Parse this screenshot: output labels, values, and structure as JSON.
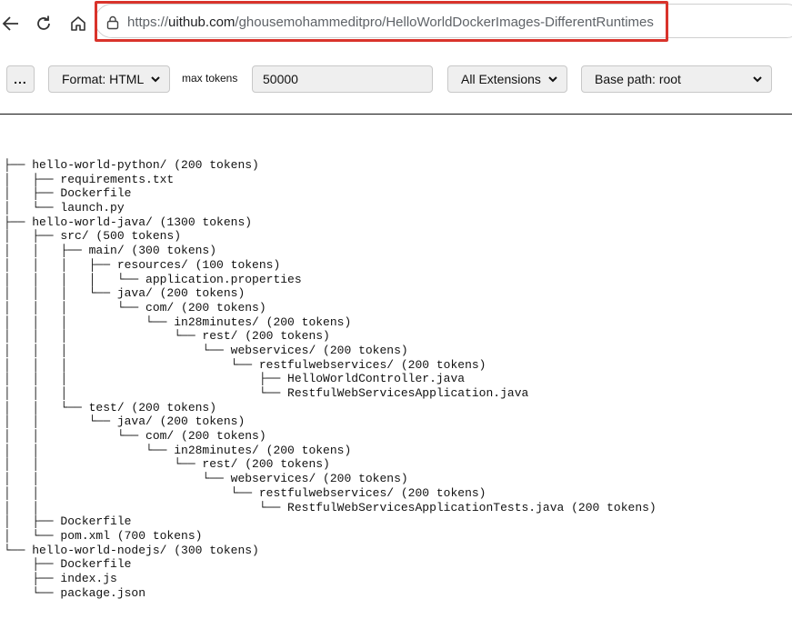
{
  "browser": {
    "url_prefix": "https://",
    "url_host": "uithub.com",
    "url_path": "/ghousemohammeditpro/HelloWorldDockerImages-DifferentRuntimes"
  },
  "toolbar": {
    "more_label": "...",
    "format_label": "Format: HTML",
    "max_tokens_label": "max tokens",
    "max_tokens_value": "50000",
    "extensions_label": "All Extensions",
    "base_path_label": "Base path: root"
  },
  "tree": [
    "├── hello-world-python/ (200 tokens)",
    "│   ├── requirements.txt",
    "│   ├── Dockerfile",
    "│   └── launch.py",
    "├── hello-world-java/ (1300 tokens)",
    "│   ├── src/ (500 tokens)",
    "│   │   ├── main/ (300 tokens)",
    "│   │   │   ├── resources/ (100 tokens)",
    "│   │   │   │   └── application.properties",
    "│   │   │   └── java/ (200 tokens)",
    "│   │   │       └── com/ (200 tokens)",
    "│   │   │           └── in28minutes/ (200 tokens)",
    "│   │   │               └── rest/ (200 tokens)",
    "│   │   │                   └── webservices/ (200 tokens)",
    "│   │   │                       └── restfulwebservices/ (200 tokens)",
    "│   │   │                           ├── HelloWorldController.java",
    "│   │   │                           └── RestfulWebServicesApplication.java",
    "│   │   └── test/ (200 tokens)",
    "│   │       └── java/ (200 tokens)",
    "│   │           └── com/ (200 tokens)",
    "│   │               └── in28minutes/ (200 tokens)",
    "│   │                   └── rest/ (200 tokens)",
    "│   │                       └── webservices/ (200 tokens)",
    "│   │                           └── restfulwebservices/ (200 tokens)",
    "│   │                               └── RestfulWebServicesApplicationTests.java (200 tokens)",
    "│   ├── Dockerfile",
    "│   └── pom.xml (700 tokens)",
    "└── hello-world-nodejs/ (300 tokens)",
    "    ├── Dockerfile",
    "    ├── index.js",
    "    └── package.json"
  ],
  "colors": {
    "highlight": "#d9332b"
  }
}
